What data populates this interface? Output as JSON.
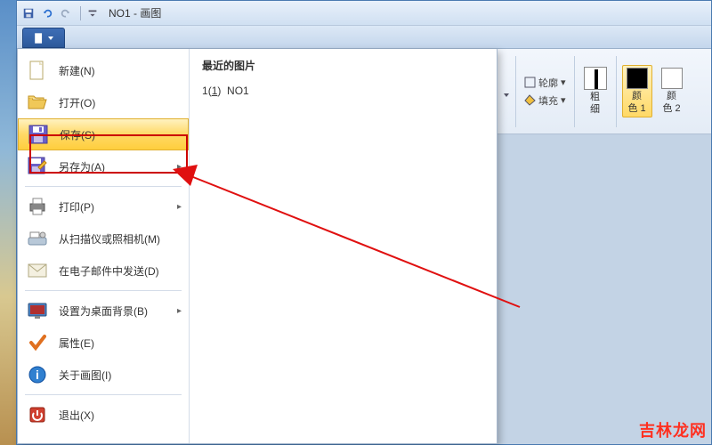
{
  "title": "NO1 - 画图",
  "menu": {
    "items": [
      {
        "label": "新建(N)",
        "icon": "file-new"
      },
      {
        "label": "打开(O)",
        "icon": "folder-open"
      },
      {
        "label": "保存(S)",
        "icon": "save",
        "selected": true
      },
      {
        "label": "另存为(A)",
        "icon": "save-as",
        "sub": true
      },
      {
        "label": "打印(P)",
        "icon": "print",
        "sub": true
      },
      {
        "label": "从扫描仪或照相机(M)",
        "icon": "scanner"
      },
      {
        "label": "在电子邮件中发送(D)",
        "icon": "email"
      },
      {
        "label": "设置为桌面背景(B)",
        "icon": "desktop-bg",
        "sub": true
      },
      {
        "label": "属性(E)",
        "icon": "properties"
      },
      {
        "label": "关于画图(I)",
        "icon": "about"
      },
      {
        "label": "退出(X)",
        "icon": "exit"
      }
    ],
    "recent_header": "最近的图片",
    "recent": [
      {
        "num": "1",
        "label": "NO1"
      }
    ]
  },
  "ribbon": {
    "outline": "轮廓",
    "fill": "填充",
    "stroke": "粗\n细",
    "color1": "颜\n色 1",
    "color2": "颜\n色 2",
    "color1_hex": "#000000",
    "color2_hex": "#ffffff"
  },
  "watermark": "吉林龙网"
}
